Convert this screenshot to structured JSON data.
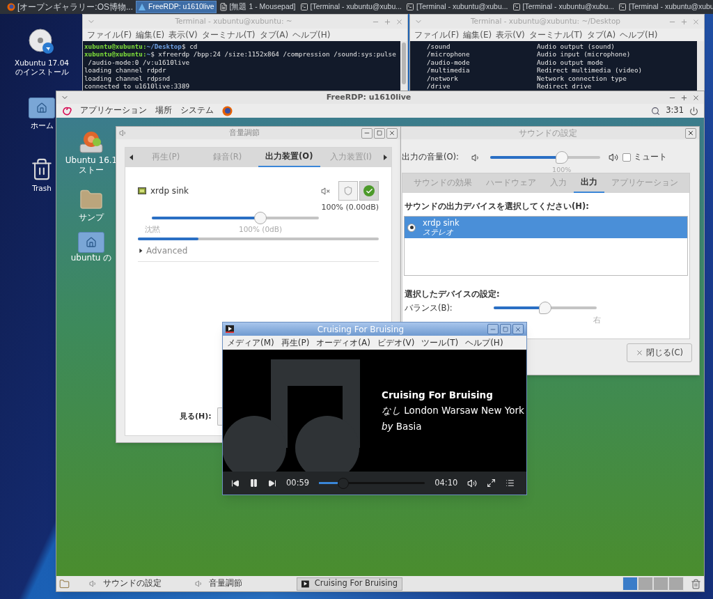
{
  "top_panel": {
    "items": [
      {
        "label": "[オープンギャラリー:OS博物...",
        "kind": "browser",
        "selected": false
      },
      {
        "label": "FreeRDP: u1610live",
        "kind": "remote",
        "selected": true
      },
      {
        "label": "[無題 1 - Mousepad]",
        "kind": "editor",
        "selected": false
      },
      {
        "label": "[Terminal - xubuntu@xubu...",
        "kind": "terminal",
        "selected": false
      },
      {
        "label": "[Terminal - xubuntu@xubu...",
        "kind": "terminal",
        "selected": false
      },
      {
        "label": "[Terminal - xubuntu@xubu...",
        "kind": "terminal",
        "selected": false
      },
      {
        "label": "[Terminal - xubuntu@xubu",
        "kind": "terminal",
        "selected": false
      }
    ]
  },
  "desktop_icons": [
    {
      "label": "Xubuntu 17.04 のインストール",
      "kind": "disc"
    },
    {
      "label": "ホーム",
      "kind": "home"
    },
    {
      "label": "Trash",
      "kind": "trash"
    }
  ],
  "terminals": [
    {
      "title": "Terminal - xubuntu@xubuntu: ~",
      "menu": [
        "ファイル(F)",
        "編集(E)",
        "表示(V)",
        "ターミナル(T)",
        "タブ(A)",
        "ヘルプ(H)"
      ],
      "lines": [
        {
          "kind": "prompt",
          "user": "xubuntu@xubuntu:",
          "path": "~/Desktop",
          "text": "$ cd"
        },
        {
          "kind": "prompt",
          "user": "xubuntu@xubuntu:",
          "path": "~",
          "text": "$ xfreerdp /bpp:24 /size:1152x864 /compression /sound:sys:pulse"
        },
        {
          "kind": "output",
          "text": " /audio-mode:0 /v:u1610live"
        },
        {
          "kind": "output",
          "text": "loading channel rdpdr"
        },
        {
          "kind": "output",
          "text": "loading channel rdpsnd"
        },
        {
          "kind": "output",
          "text": "connected to u1610live:3389"
        }
      ]
    },
    {
      "title": "Terminal - xubuntu@xubuntu: ~/Desktop",
      "menu": [
        "ファイル(F)",
        "編集(E)",
        "表示(V)",
        "ターミナル(T)",
        "タブ(A)",
        "ヘルプ(H)"
      ],
      "lines": [
        {
          "kind": "option",
          "option": "/sound",
          "text": "Audio output (sound)"
        },
        {
          "kind": "option",
          "option": "/microphone",
          "text": "Audio input (microphone)"
        },
        {
          "kind": "option",
          "option": "/audio-mode",
          "text": "Audio output mode"
        },
        {
          "kind": "option",
          "option": "/multimedia",
          "text": "Redirect multimedia (video)"
        },
        {
          "kind": "option",
          "option": "/network",
          "text": "Network connection type"
        },
        {
          "kind": "option",
          "option": "/drive",
          "text": "Redirect drive"
        }
      ]
    }
  ],
  "freerdp": {
    "title": "FreeRDP: u1610live",
    "panel": {
      "menus": [
        "アプリケーション",
        "場所",
        "システム"
      ],
      "clock": "3:31"
    },
    "desktop_icons": [
      {
        "lines": [
          "Ubuntu 16.1",
          "ストー"
        ],
        "kind": "installer"
      },
      {
        "lines": [
          "サンプ"
        ],
        "kind": "folder"
      },
      {
        "lines": [
          "ubuntu の"
        ],
        "kind": "home"
      }
    ],
    "volume_control": {
      "title": "音量調節",
      "tabs": [
        {
          "label": "再生(P)",
          "selected": false
        },
        {
          "label": "録音(R)",
          "selected": false
        },
        {
          "label": "出力装置(O)",
          "selected": true
        },
        {
          "label": "入力装置(I)",
          "selected": false
        }
      ],
      "device": {
        "name": "xrdp sink",
        "reading": "100% (0.00dB)",
        "level": 0.65,
        "min_label": "沈黙",
        "mark_label": "100% (0dB)",
        "meter": {
          "level": 0.25
        },
        "muted": false,
        "locked": true
      },
      "advanced": {
        "label": "Advanced",
        "expanded": false
      },
      "view_label": "見る(H):"
    },
    "sound_settings": {
      "title": "サウンドの設定",
      "output_volume": {
        "label": "出力の音量(O):",
        "level": 0.65,
        "reading": "100%",
        "mute": {
          "label": "ミュート",
          "checked": false
        }
      },
      "tabs": [
        {
          "label": "サウンドの効果",
          "selected": false
        },
        {
          "label": "ハードウェア",
          "selected": false
        },
        {
          "label": "入力",
          "selected": false
        },
        {
          "label": "出力",
          "selected": true
        },
        {
          "label": "アプリケーション",
          "selected": false
        }
      ],
      "device_heading": "サウンドの出力デバイスを選択してください(H):",
      "devices": [
        {
          "name": "xrdp sink",
          "profile": "ステレオ",
          "selected": true
        }
      ],
      "settings_heading": "選択したデバイスの設定:",
      "balance": {
        "label": "バランス(B):",
        "level": 0.5,
        "right_label": "右"
      },
      "close_button": "閉じる(C)"
    },
    "media_player": {
      "title": "Cruising For Bruising",
      "menus": [
        "メディア(M)",
        "再生(P)",
        "オーディオ(A)",
        "ビデオ(V)",
        "ツール(T)",
        "ヘルプ(H)"
      ],
      "track": {
        "title": "Cruising For Bruising",
        "album": "*なし* London Warsaw New York",
        "artist": "*by* Basia"
      },
      "controls": {
        "playing": true,
        "position": "00:59",
        "level": 0.23,
        "duration": "04:10"
      }
    },
    "taskbar": {
      "items": [
        {
          "label": "サウンドの設定",
          "kind": "settings",
          "selected": false
        },
        {
          "label": "音量調節",
          "kind": "settings",
          "selected": false
        },
        {
          "label": "Cruising For Bruising",
          "kind": "player",
          "selected": true
        }
      ],
      "workspaces": [
        {
          "selected": true
        },
        {
          "selected": false
        },
        {
          "selected": false
        },
        {
          "selected": false
        }
      ]
    }
  }
}
